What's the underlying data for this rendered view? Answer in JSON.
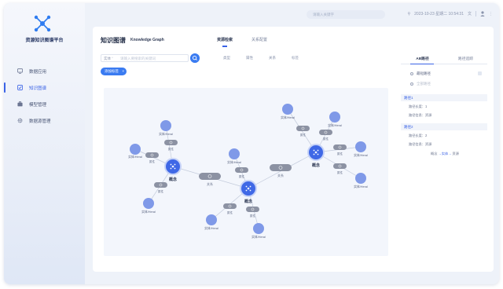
{
  "app": {
    "brand": "资源知识图谱平台",
    "accent": "#3a63e6"
  },
  "sidebar": {
    "items": [
      {
        "label": "数据应用",
        "icon": "monitor-icon"
      },
      {
        "label": "知识图谱",
        "icon": "graph-icon",
        "active": true
      },
      {
        "label": "模型管理",
        "icon": "briefcase-icon"
      },
      {
        "label": "数据源管理",
        "icon": "gear-icon"
      }
    ]
  },
  "header": {
    "search_placeholder": "请输入关键字",
    "datetime": "2023-10-23 星期二 10:54:31",
    "lang": "文"
  },
  "main": {
    "title": "知识图谱",
    "subtitle": "Knowledge Graph",
    "tabs": [
      {
        "label": "资源检索",
        "active": true
      },
      {
        "label": "关系配置"
      }
    ],
    "filter": {
      "select_label": "实体",
      "placeholder": "请输入要搜索的关键词"
    },
    "filter_tags": [
      "类型",
      "属性",
      "关系",
      "标签"
    ],
    "chip": "添加标签"
  },
  "graph": {
    "concept_label": "概念",
    "relation_label": "关系",
    "attribute_label": "属性",
    "entities": [
      "实体/Heral",
      "实体/Heral",
      "实体/Heral",
      "实体/Heral",
      "实体/Heral",
      "实体/Heral",
      "实体/Heral",
      "实体/Heral",
      "实体/Heral",
      "实体/Heral",
      "实体/Heral"
    ]
  },
  "right_panel": {
    "tabs": [
      {
        "label": "AB路径",
        "active": true
      },
      {
        "label": "路径追踪"
      }
    ],
    "options": [
      {
        "label": "最短路径",
        "dim": false
      },
      {
        "label": "全部路径",
        "dim": true
      }
    ],
    "sections": [
      {
        "title": "路径1",
        "rows": [
          "路径长度：1",
          "路径信息：资源"
        ]
      },
      {
        "title": "路径2",
        "rows": [
          "路径长度：2",
          "路径信息：资源"
        ],
        "extra": {
          "prefix": "概念",
          "mid": "实体",
          "suffix": "资源"
        }
      }
    ]
  }
}
